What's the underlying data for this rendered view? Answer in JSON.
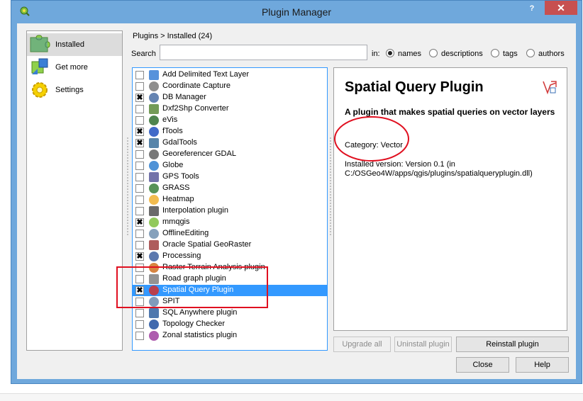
{
  "window": {
    "title": "Plugin Manager",
    "help_label": "?",
    "close_label": "✕"
  },
  "sidebar": {
    "items": [
      {
        "label": "Installed",
        "icon": "installed-puzzle-icon"
      },
      {
        "label": "Get more",
        "icon": "get-more-puzzle-icon"
      },
      {
        "label": "Settings",
        "icon": "settings-gear-icon"
      }
    ]
  },
  "breadcrumb": "Plugins > Installed (24)",
  "search": {
    "label": "Search",
    "value": "",
    "placeholder": "",
    "in_label": "in:"
  },
  "search_scopes": [
    {
      "label": "names",
      "checked": true
    },
    {
      "label": "descriptions",
      "checked": false
    },
    {
      "label": "tags",
      "checked": false
    },
    {
      "label": "authors",
      "checked": false
    }
  ],
  "plugins": [
    {
      "name": "Add Delimited Text Layer",
      "checked": false,
      "icon": "delimited-text-icon"
    },
    {
      "name": "Coordinate Capture",
      "checked": false,
      "icon": "crosshair-icon"
    },
    {
      "name": "DB Manager",
      "checked": true,
      "icon": "database-icon"
    },
    {
      "name": "Dxf2Shp Converter",
      "checked": false,
      "icon": "dxf-icon"
    },
    {
      "name": "eVis",
      "checked": false,
      "icon": "evis-icon"
    },
    {
      "name": "fTools",
      "checked": true,
      "icon": "ftools-icon"
    },
    {
      "name": "GdalTools",
      "checked": true,
      "icon": "gdal-icon"
    },
    {
      "name": "Georeferencer GDAL",
      "checked": false,
      "icon": "georeferencer-icon"
    },
    {
      "name": "Globe",
      "checked": false,
      "icon": "globe-icon"
    },
    {
      "name": "GPS Tools",
      "checked": false,
      "icon": "gps-icon"
    },
    {
      "name": "GRASS",
      "checked": false,
      "icon": "grass-icon"
    },
    {
      "name": "Heatmap",
      "checked": false,
      "icon": "heatmap-icon"
    },
    {
      "name": "Interpolation plugin",
      "checked": false,
      "icon": "interpolation-icon"
    },
    {
      "name": "mmqgis",
      "checked": true,
      "icon": "mmqgis-icon"
    },
    {
      "name": "OfflineEditing",
      "checked": false,
      "icon": "offline-editing-icon"
    },
    {
      "name": "Oracle Spatial GeoRaster",
      "checked": false,
      "icon": "oracle-icon"
    },
    {
      "name": "Processing",
      "checked": true,
      "icon": "processing-gear-icon"
    },
    {
      "name": "Raster Terrain Analysis plugin",
      "checked": false,
      "icon": "terrain-icon"
    },
    {
      "name": "Road graph plugin",
      "checked": false,
      "icon": "road-graph-icon"
    },
    {
      "name": "Spatial Query Plugin",
      "checked": true,
      "icon": "spatial-query-icon",
      "selected": true
    },
    {
      "name": "SPIT",
      "checked": false,
      "icon": "spit-icon"
    },
    {
      "name": "SQL Anywhere plugin",
      "checked": false,
      "icon": "sql-anywhere-icon"
    },
    {
      "name": "Topology Checker",
      "checked": false,
      "icon": "topology-icon"
    },
    {
      "name": "Zonal statistics plugin",
      "checked": false,
      "icon": "zonal-stats-icon"
    }
  ],
  "details": {
    "title": "Spatial Query Plugin",
    "description": "A plugin that makes spatial queries on vector layers",
    "category": "Category: Vector",
    "installed": "Installed version: Version 0.1 (in C:/OSGeo4W/apps/qgis/plugins/spatialqueryplugin.dll)"
  },
  "buttons": {
    "upgrade_all": "Upgrade all",
    "uninstall": "Uninstall plugin",
    "reinstall": "Reinstall plugin",
    "close": "Close",
    "help": "Help"
  },
  "colors": {
    "window_frame": "#6fa8dc",
    "selection": "#3399ff",
    "annotation_red": "#e01020"
  }
}
